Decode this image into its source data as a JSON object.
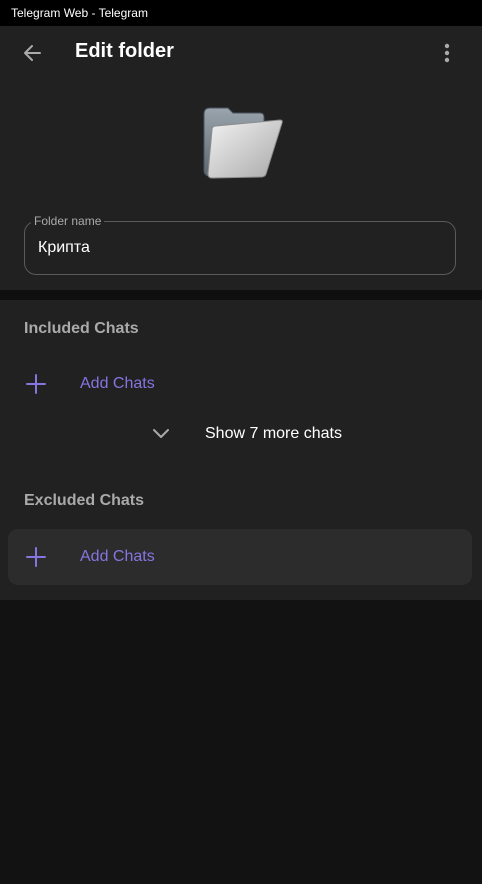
{
  "window": {
    "title": "Telegram Web - Telegram"
  },
  "header": {
    "title": "Edit folder",
    "back_icon": "arrow-left-icon",
    "menu_icon": "more-vertical-icon"
  },
  "folder": {
    "icon": "folder-icon",
    "name_label": "Folder name",
    "name_value": "Крипта"
  },
  "included": {
    "title": "Included Chats",
    "add_label": "Add Chats",
    "show_more_label": "Show 7 more chats"
  },
  "excluded": {
    "title": "Excluded Chats",
    "add_label": "Add Chats"
  },
  "colors": {
    "accent": "#8774e1",
    "panel": "#212121",
    "background": "#121212"
  }
}
